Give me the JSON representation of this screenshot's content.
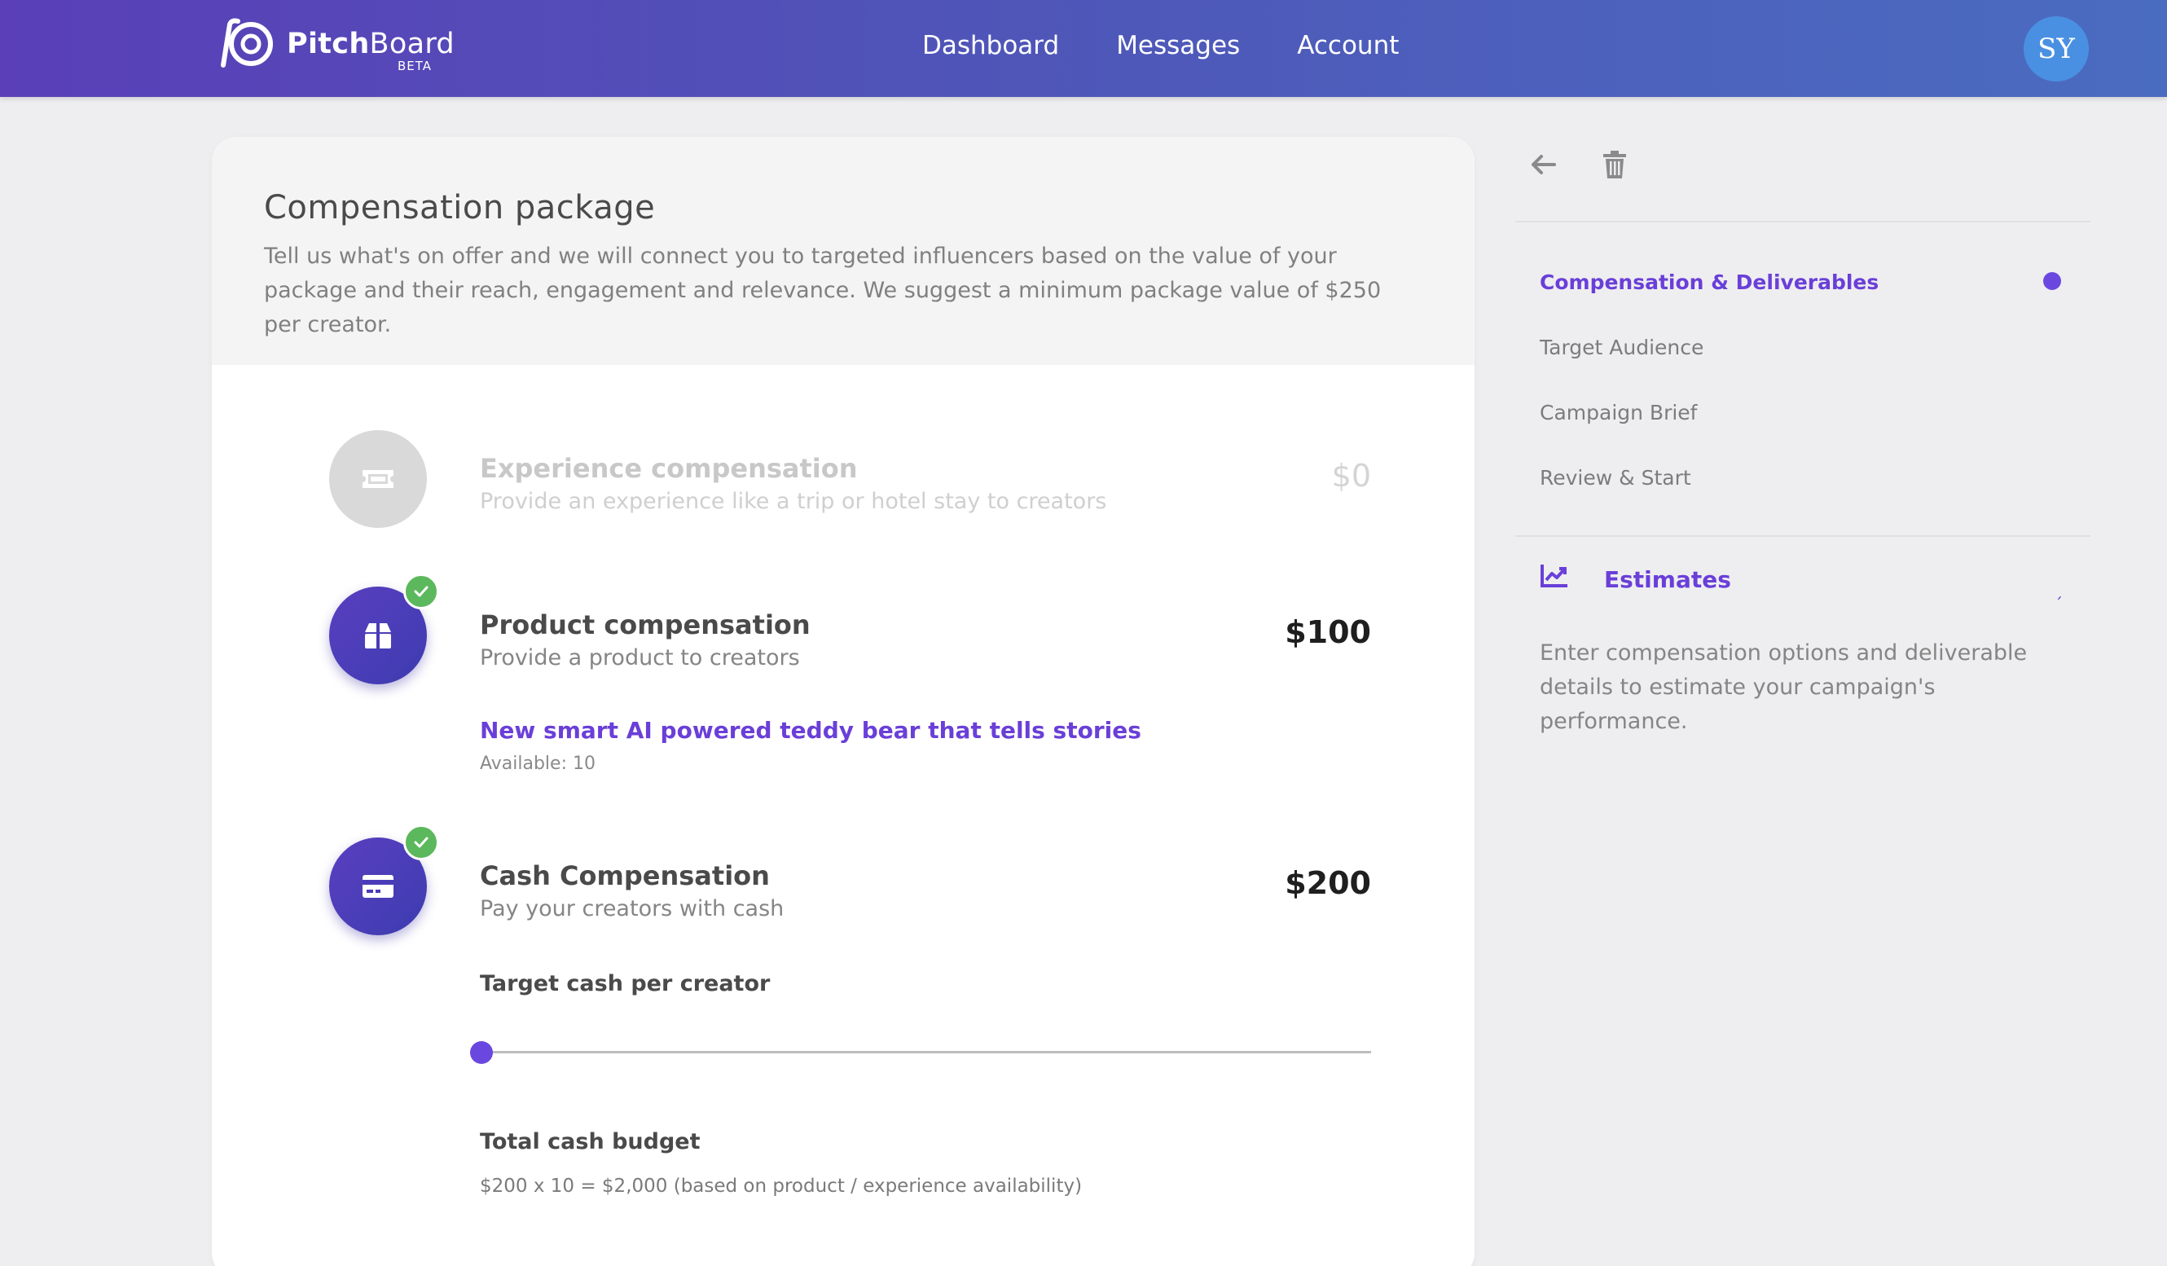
{
  "header": {
    "brand_name": "PitchBoard",
    "brand_strong": "Pitch",
    "brand_rest": "Board",
    "brand_badge": "BETA",
    "nav": [
      {
        "label": "Dashboard"
      },
      {
        "label": "Messages"
      },
      {
        "label": "Account"
      }
    ],
    "avatar_initials": "SY"
  },
  "main": {
    "title": "Compensation package",
    "description": "Tell us what's on offer and we will connect you to targeted influencers based on the value of your package and their reach, engagement and relevance. We suggest a minimum package value of $250 per creator.",
    "options": [
      {
        "title": "Experience compensation",
        "subtitle": "Provide an experience like a trip or hotel stay to creators",
        "amount": "$0",
        "selected": false,
        "icon": "ticket-icon"
      },
      {
        "title": "Product compensation",
        "subtitle": "Provide a product to creators",
        "amount": "$100",
        "selected": true,
        "icon": "box-icon",
        "product_name": "New smart AI powered teddy bear that tells stories",
        "product_availability": "Available: 10"
      },
      {
        "title": "Cash Compensation",
        "subtitle": "Pay your creators with cash",
        "amount": "$200",
        "selected": true,
        "icon": "credit-card-icon",
        "target_label": "Target cash per creator",
        "slider_level": 0,
        "budget_label": "Total cash budget",
        "budget_note": "$200 x 10 = $2,000 (based on product / experience availability)"
      }
    ]
  },
  "sidebar": {
    "tools": [
      "back-arrow-icon",
      "trash-icon"
    ],
    "steps": [
      {
        "label": "Compensation & Deliverables",
        "active": true
      },
      {
        "label": "Target Audience",
        "active": false
      },
      {
        "label": "Campaign Brief",
        "active": false
      },
      {
        "label": "Review & Start",
        "active": false
      }
    ],
    "estimates": {
      "title": "Estimates",
      "icon": "chart-line-icon",
      "chevron": "ˏ",
      "text": "Enter compensation options and deliverable details to estimate your campaign's performance."
    }
  },
  "colors": {
    "accent": "#6a3fd8",
    "header_start": "#5a3fb8",
    "header_end": "#4a6cc0",
    "success": "#5cb85c",
    "avatar": "#4a90e2"
  }
}
